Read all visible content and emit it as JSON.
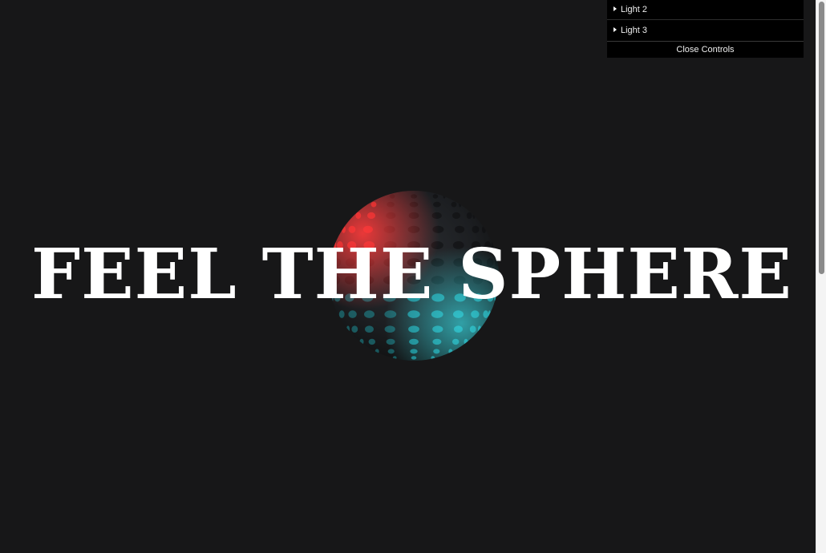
{
  "headline": "FEEL THE SPHERE",
  "controls": {
    "folders": [
      {
        "label": "Light 2",
        "icon": "triangle-right-icon"
      },
      {
        "label": "Light 3",
        "icon": "triangle-right-icon"
      }
    ],
    "close_label": "Close Controls"
  },
  "colors": {
    "background": "#171718",
    "text": "#ffffff",
    "light_red": "#ff2a2a",
    "light_cyan": "#22d4e0",
    "panel": "#000000"
  }
}
